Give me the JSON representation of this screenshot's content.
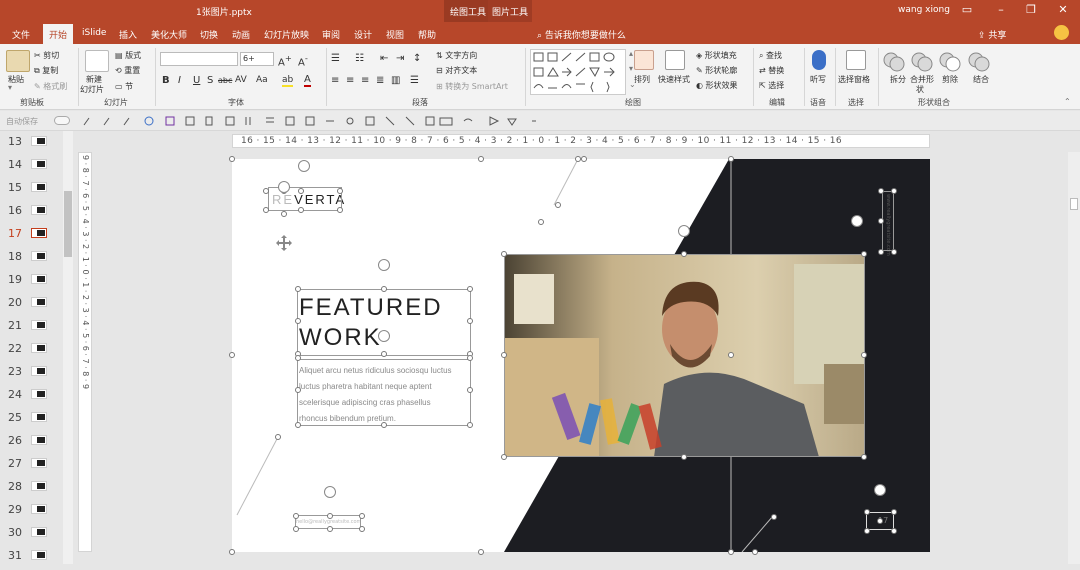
{
  "title_bar": {
    "filename": "1张图片.pptx",
    "context_tabs": [
      {
        "group": "绘图工具",
        "tab": "格式"
      },
      {
        "group": "图片工具",
        "tab": "格式"
      }
    ],
    "user": "wang xiong"
  },
  "menu": {
    "items": [
      "文件",
      "开始",
      "iSlide",
      "插入",
      "美化大师",
      "切换",
      "动画",
      "幻灯片放映",
      "审阅",
      "设计",
      "视图",
      "帮助"
    ],
    "active": "开始",
    "tell_me": "告诉我你想要做什么",
    "share": "共享"
  },
  "ribbon": {
    "clipboard": {
      "paste": "粘贴",
      "cut": "剪切",
      "copy": "复制",
      "format_painter": "格式刷",
      "label": "剪贴板"
    },
    "slides": {
      "new_slide_1": "新建",
      "new_slide_2": "幻灯片",
      "layout": "版式",
      "reset": "重置",
      "section": "节",
      "label": "幻灯片"
    },
    "font": {
      "size": "6+",
      "label": "字体",
      "buttons": [
        "B",
        "I",
        "U",
        "S",
        "abc",
        "AV",
        "Aa",
        "A"
      ]
    },
    "paragraph": {
      "text_direction": "文字方向",
      "align_text": "对齐文本",
      "smartart": "转换为 SmartArt",
      "label": "段落"
    },
    "drawing": {
      "arrange": "排列",
      "quick_styles": "快速样式",
      "shape_fill": "形状填充",
      "shape_outline": "形状轮廓",
      "shape_effects": "形状效果",
      "label": "绘图"
    },
    "editing": {
      "find": "查找",
      "replace": "替换",
      "select": "选择",
      "label": "编辑"
    },
    "voice": {
      "dictate": "听写",
      "label": "语音"
    },
    "select_group": {
      "selection_pane": "选择窗格",
      "label": "选择"
    },
    "shape_combine": {
      "split": "拆分",
      "union_1": "合并形",
      "union_2": "状",
      "subtract": "剪除",
      "combine": "结合",
      "label": "形状组合"
    }
  },
  "qat": {
    "autosave": "自动保存"
  },
  "slides_panel": {
    "numbers": [
      "13",
      "14",
      "15",
      "16",
      "17",
      "18",
      "19",
      "20",
      "21",
      "22",
      "23",
      "24",
      "25",
      "26",
      "27",
      "28",
      "29",
      "30",
      "31"
    ],
    "active": "17"
  },
  "ruler": {
    "horizontal": "16 · 15 · 14 · 13 · 12 · 11 · 10 · 9 · 8 · 7 · 6 · 5 · 4 · 3 · 2 · 1 · 0 · 1 · 2 · 3 · 4 · 5 · 6 · 7 · 8 · 9 · 10 · 11 · 12 · 13 · 14 · 15 · 16",
    "vertical": "9 · 8 · 7 · 6 · 5 · 4 · 3 · 2 · 1 · 0 · 1 · 2 · 3 · 4 · 5 · 6 · 7 · 8 · 9"
  },
  "slide": {
    "logo_prefix": "RE",
    "logo_text": "VERTA",
    "heading_line1": "FEATURED",
    "heading_line2": "WORK",
    "body": [
      "Aliquet arcu netus ridiculus sociosqu luctus",
      "luctus pharetra habitant neque aptent",
      "scelerisque adipiscing cras phasellus",
      "rhoncus bibendum pretium."
    ],
    "email": "hello@reallygreatsite.com",
    "side_text": "www.reallygreatsite.com",
    "page_number": "17",
    "colors": {
      "dark": "#1c1d22",
      "accent": "#b7472a"
    }
  }
}
